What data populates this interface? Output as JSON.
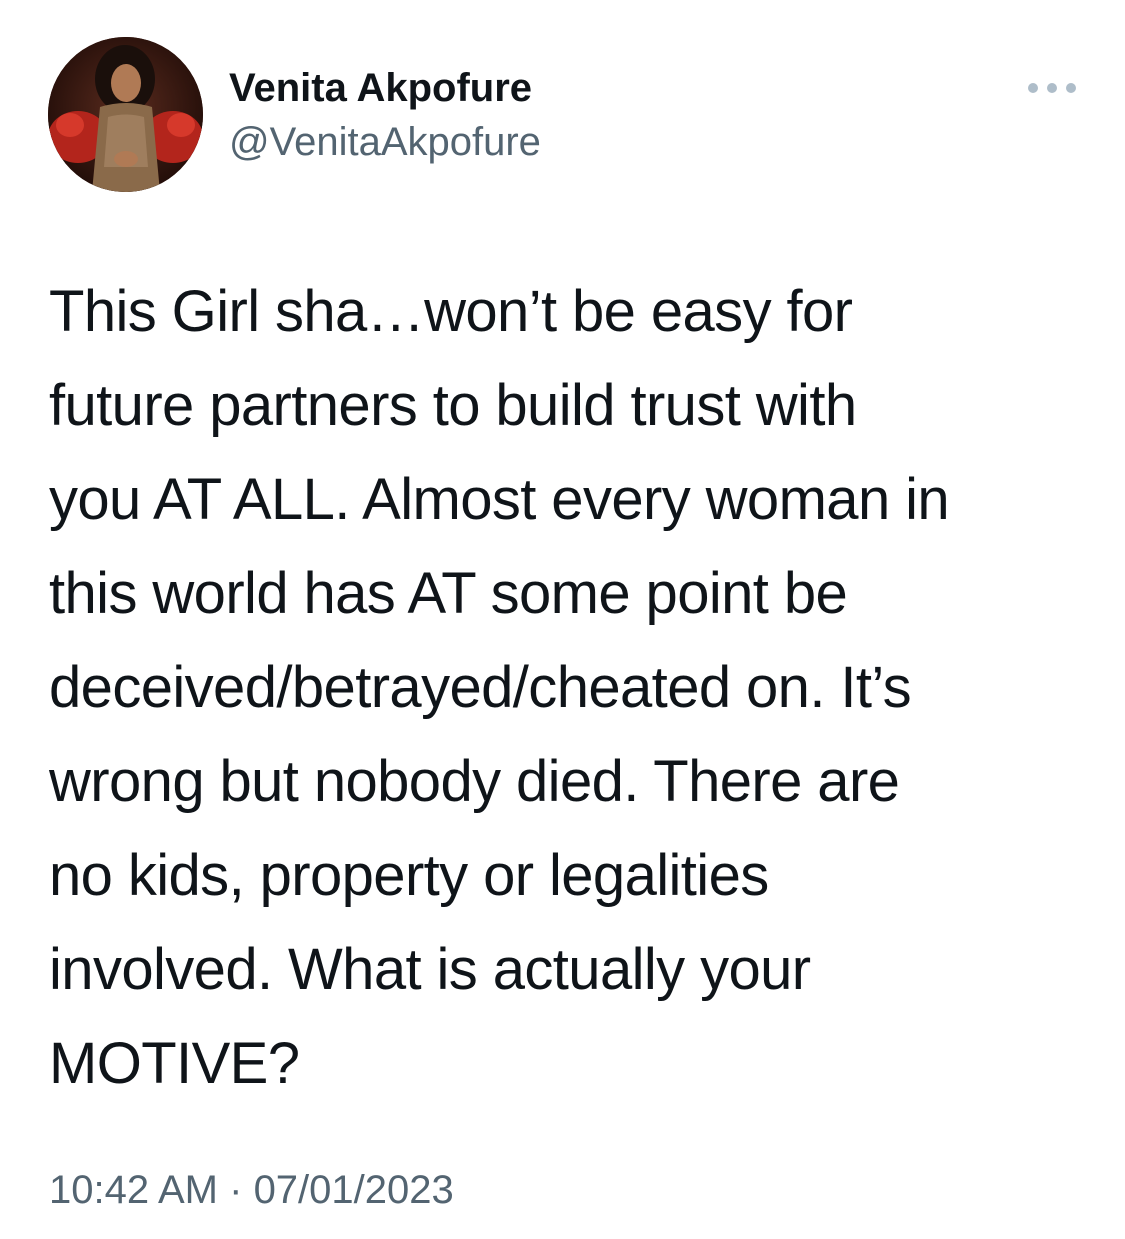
{
  "author": {
    "display_name": "Venita Akpofure",
    "handle": "@VenitaAkpofure",
    "avatar_icon": "profile-photo"
  },
  "more_icon": "more-options-icon",
  "tweet": {
    "lines": [
      "This Girl sha…won’t be easy for",
      "future partners to build trust with",
      "you AT ALL. Almost every woman in",
      "this world has AT some point be",
      "deceived/betrayed/cheated on. It’s",
      "wrong but nobody died. There are",
      "no kids, property or legalities",
      "involved. What is actually your",
      "MOTIVE?"
    ]
  },
  "meta": {
    "time": "10:42 AM",
    "separator": " · ",
    "date": "07/01/2023"
  },
  "colors": {
    "text": "#0f1419",
    "secondary": "#536471",
    "more_dots": "#aebdc9"
  }
}
